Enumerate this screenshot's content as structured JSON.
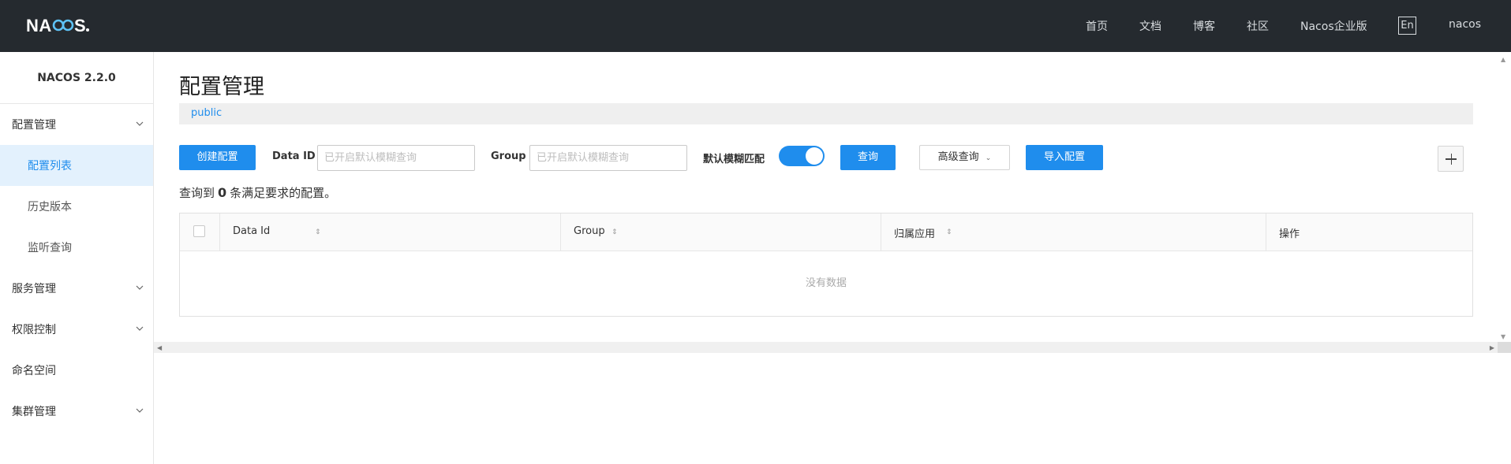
{
  "navbar": {
    "logo": "NACOS.",
    "links": [
      "首页",
      "文档",
      "博客",
      "社区",
      "Nacos企业版"
    ],
    "lang": "En",
    "user": "nacos"
  },
  "sidebar": {
    "version": "NACOS 2.2.0",
    "groups": {
      "config": "配置管理",
      "config_list": "配置列表",
      "history": "历史版本",
      "listener": "监听查询",
      "service": "服务管理",
      "auth": "权限控制",
      "namespace": "命名空间",
      "cluster": "集群管理"
    }
  },
  "main": {
    "title": "配置管理",
    "namespace": "public",
    "create_btn": "创建配置",
    "dataid_label": "Data ID",
    "dataid_placeholder": "已开启默认模糊查询",
    "group_label": "Group",
    "group_placeholder": "已开启默认模糊查询",
    "fuzzy_label": "默认模糊匹配",
    "fuzzy_on": true,
    "query_btn": "查询",
    "advanced_btn": "高级查询",
    "import_btn": "导入配置",
    "result_prefix": "查询到",
    "result_count": "0",
    "result_suffix": "条满足要求的配置。"
  },
  "table": {
    "columns": [
      "Data Id",
      "Group",
      "归属应用",
      "操作"
    ],
    "empty_text": "没有数据"
  },
  "colors": {
    "navbar_bg": "#252a2f",
    "primary": "#1f8ded",
    "active_menu_bg": "#e3f1fd"
  }
}
